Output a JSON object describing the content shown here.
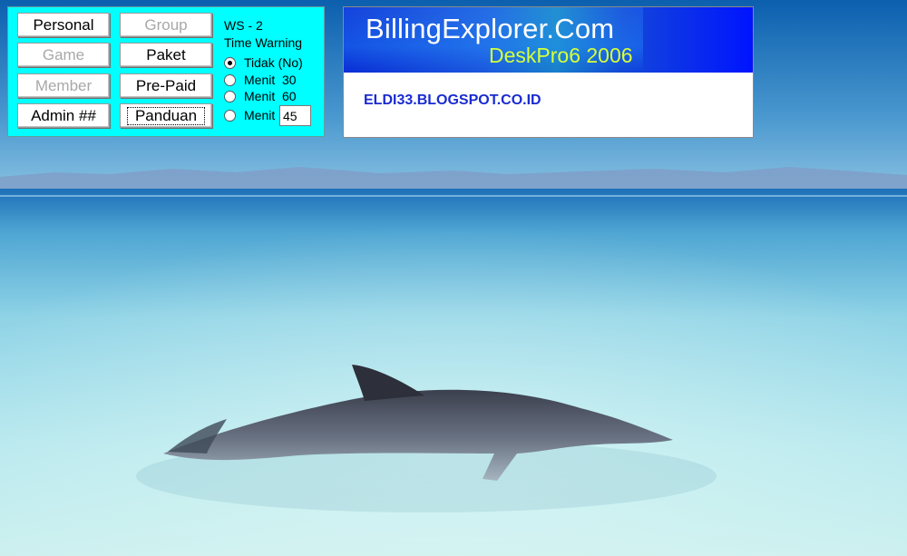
{
  "panel": {
    "buttons": {
      "personal": "Personal",
      "group": "Group",
      "game": "Game",
      "paket": "Paket",
      "member": "Member",
      "pre_paid": "Pre-Paid",
      "admin": "Admin ##",
      "panduan": "Panduan"
    },
    "workstation": "WS - 2",
    "time_warning_label": "Time Warning",
    "options": [
      {
        "label": "Tidak (No)",
        "checked": true
      },
      {
        "label": "Menit  30",
        "checked": false
      },
      {
        "label": "Menit  60",
        "checked": false
      },
      {
        "label": "Menit",
        "checked": false
      }
    ],
    "custom_minutes": "45"
  },
  "banner": {
    "title": "BillingExplorer.Com",
    "subtitle": "DeskPro6 2006",
    "url": "ELDI33.BLOGSPOT.CO.ID"
  },
  "colors": {
    "panel_bg": "#00ffff",
    "banner_head_blue": "#0014ff",
    "subtitle_green": "#d7ff39",
    "url_blue": "#1a2bd0"
  }
}
